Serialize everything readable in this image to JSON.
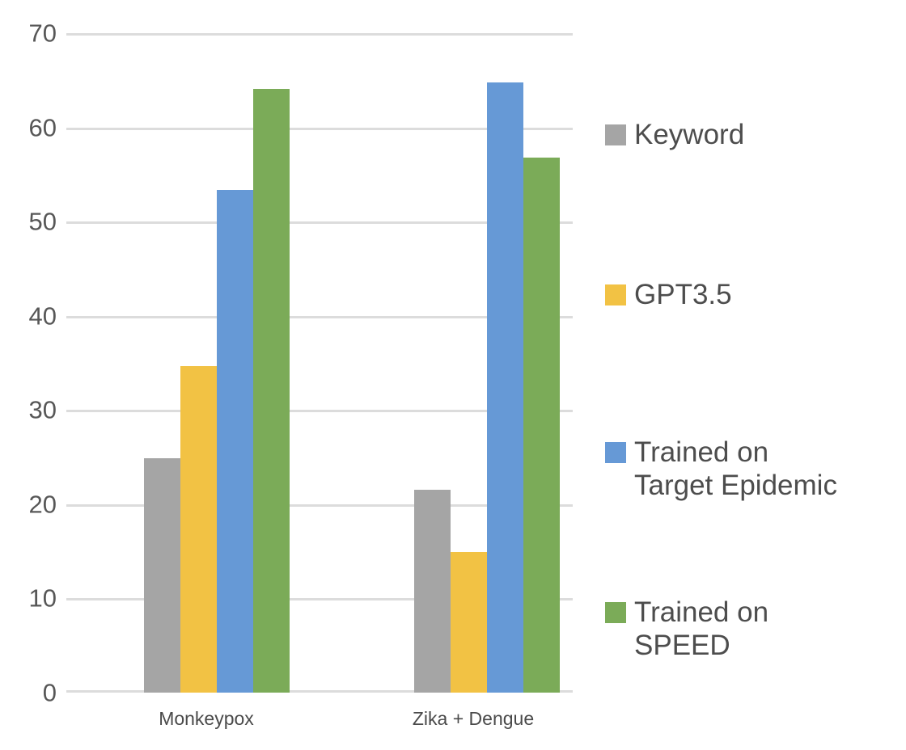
{
  "chart_data": {
    "type": "bar",
    "title": "",
    "subtitle": "",
    "xlabel": "",
    "ylabel": "",
    "categories": [
      "Monkeypox",
      "Zika + Dengue"
    ],
    "series": [
      {
        "name": "Keyword",
        "color": "#A5A5A5",
        "values": [
          24.9,
          21.5
        ]
      },
      {
        "name": "GPT3.5",
        "color": "#F2C244",
        "values": [
          34.7,
          14.9
        ]
      },
      {
        "name": "Trained on Target Epidemic",
        "color": "#6699D6",
        "values": [
          53.4,
          64.8
        ]
      },
      {
        "name": "Trained on SPEED",
        "color": "#7BAB58",
        "values": [
          64.1,
          56.8
        ]
      }
    ],
    "ylim": [
      0,
      70
    ],
    "yticks": [
      0,
      10,
      20,
      30,
      40,
      50,
      60,
      70
    ],
    "ytick_labels": [
      "0",
      "10",
      "20",
      "30",
      "40",
      "50",
      "60",
      "70"
    ],
    "grid": true,
    "grid_axis": "y",
    "grid_color": "#DCDCDC",
    "legend_position": "right",
    "background": "#FFFFFF",
    "bar_group_gap": true
  },
  "legend": {
    "items": [
      {
        "label": "Keyword",
        "color": "#A5A5A5"
      },
      {
        "label": "GPT3.5",
        "color": "#F2C244"
      },
      {
        "label": "Trained on\nTarget Epidemic",
        "color": "#6699D6"
      },
      {
        "label": "Trained on\nSPEED",
        "color": "#7BAB58"
      }
    ]
  },
  "axes": {
    "y": {
      "ticks": [
        "70",
        "60",
        "50",
        "40",
        "30",
        "20",
        "10",
        "0"
      ]
    },
    "x": {
      "ticks": [
        "Monkeypox",
        "Zika + Dengue"
      ]
    }
  }
}
